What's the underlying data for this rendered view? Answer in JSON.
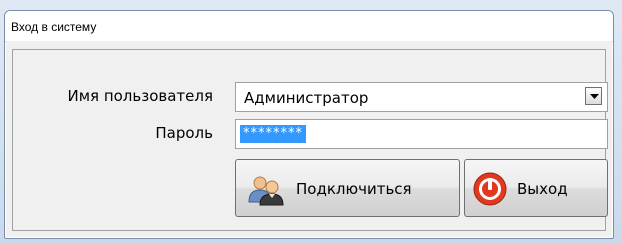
{
  "window": {
    "title": "Вход в систему"
  },
  "form": {
    "username_label": "Имя пользователя",
    "username_value": "Администратор",
    "password_label": "Пароль",
    "password_value": "********"
  },
  "buttons": {
    "connect_label": "Подключиться",
    "connect_icon": "users-icon",
    "exit_label": "Выход",
    "exit_icon": "power-icon"
  },
  "colors": {
    "selection": "#3399ff",
    "exit_icon": "#e0391f"
  }
}
